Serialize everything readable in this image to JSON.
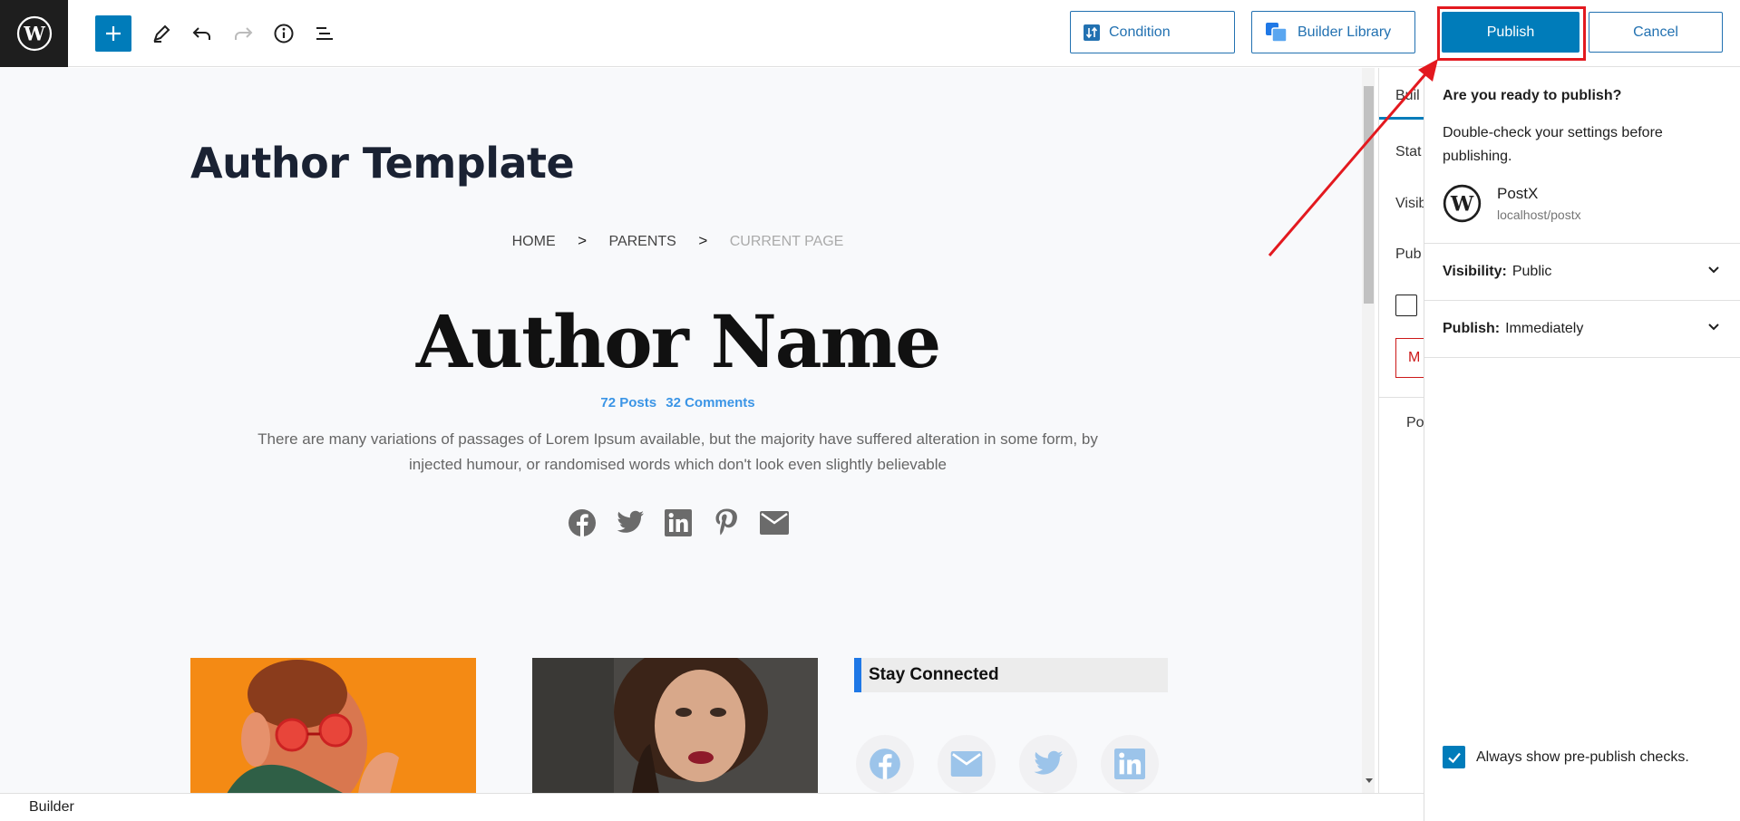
{
  "toolbar": {
    "condition_label": "Condition",
    "builder_library_label": "Builder Library",
    "publish_label": "Publish",
    "cancel_label": "Cancel"
  },
  "canvas": {
    "page_title": "Author Template",
    "breadcrumb": {
      "home": "HOME",
      "parents": "PARENTS",
      "current": "CURRENT PAGE",
      "separator": ">"
    },
    "author_name": "Author Name",
    "stats": {
      "posts": "72 Posts",
      "comments": "32 Comments"
    },
    "bio": "There are many variations of passages of Lorem Ipsum available, but the majority have suffered alteration in some form, by injected humour, or randomised words which don't look even slightly believable",
    "social_icons": [
      "facebook-icon",
      "twitter-icon",
      "linkedin-icon",
      "pinterest-icon",
      "email-icon"
    ],
    "stay_connected_title": "Stay Connected",
    "stay_connected_icons": [
      "facebook-icon",
      "email-icon",
      "twitter-icon",
      "linkedin-icon"
    ]
  },
  "sidebar_partial": {
    "tab": "Buil",
    "status": "Stat",
    "visibility": "Visib",
    "publish": "Pub",
    "move": "M",
    "post": "Po"
  },
  "publish_panel": {
    "question": "Are you ready to publish?",
    "description": "Double-check your settings before publishing.",
    "site_name": "PostX",
    "site_url": "localhost/postx",
    "visibility_label": "Visibility:",
    "visibility_value": "Public",
    "publish_label": "Publish:",
    "publish_value": "Immediately",
    "always_show_checks": "Always show pre-publish checks."
  },
  "footer": {
    "label": "Builder"
  },
  "colors": {
    "accent": "#007cba",
    "highlight": "#e3191f",
    "link": "#3b95e6"
  }
}
